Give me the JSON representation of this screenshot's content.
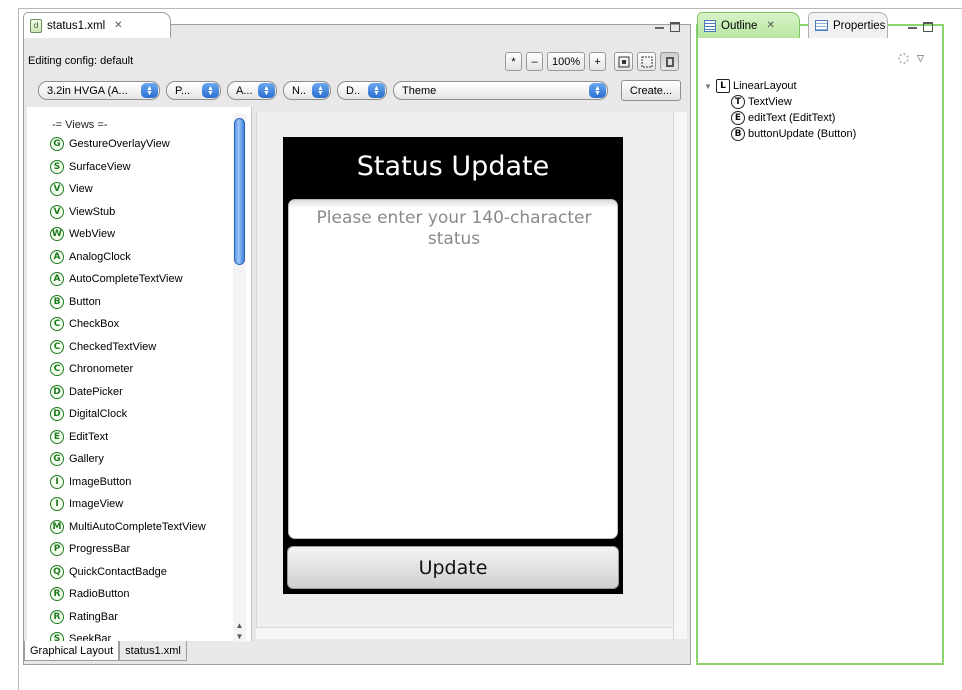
{
  "editor": {
    "tab_label": "status1.xml",
    "config_label": "Editing config:  default",
    "zoom": {
      "star": "*",
      "minus": "–",
      "level": "100%",
      "plus": "+"
    },
    "selects": [
      {
        "label": "3.2in HVGA (A...",
        "width": 122
      },
      {
        "label": "P...",
        "width": 55
      },
      {
        "label": "A...",
        "width": 50
      },
      {
        "label": "N..",
        "width": 48
      },
      {
        "label": "D..",
        "width": 50
      },
      {
        "label": "Theme",
        "width": 215
      }
    ],
    "create_label": "Create...",
    "bottom_tabs": [
      "Graphical Layout",
      "status1.xml"
    ]
  },
  "palette": {
    "header": "-= Views =-",
    "items": [
      {
        "letter": "G",
        "label": "GestureOverlayView"
      },
      {
        "letter": "S",
        "label": "SurfaceView"
      },
      {
        "letter": "V",
        "label": "View"
      },
      {
        "letter": "V",
        "label": "ViewStub"
      },
      {
        "letter": "W",
        "label": "WebView"
      },
      {
        "letter": "A",
        "label": "AnalogClock"
      },
      {
        "letter": "A",
        "label": "AutoCompleteTextView"
      },
      {
        "letter": "B",
        "label": "Button"
      },
      {
        "letter": "C",
        "label": "CheckBox"
      },
      {
        "letter": "C",
        "label": "CheckedTextView"
      },
      {
        "letter": "C",
        "label": "Chronometer"
      },
      {
        "letter": "D",
        "label": "DatePicker"
      },
      {
        "letter": "D",
        "label": "DigitalClock"
      },
      {
        "letter": "E",
        "label": "EditText"
      },
      {
        "letter": "G",
        "label": "Gallery"
      },
      {
        "letter": "I",
        "label": "ImageButton"
      },
      {
        "letter": "I",
        "label": "ImageView"
      },
      {
        "letter": "M",
        "label": "MultiAutoCompleteTextView"
      },
      {
        "letter": "P",
        "label": "ProgressBar"
      },
      {
        "letter": "Q",
        "label": "QuickContactBadge"
      },
      {
        "letter": "R",
        "label": "RadioButton"
      },
      {
        "letter": "R",
        "label": "RatingBar"
      },
      {
        "letter": "S",
        "label": "SeekBar"
      }
    ]
  },
  "preview": {
    "title": "Status Update",
    "hint": "Please enter your 140-character status",
    "button_label": "Update"
  },
  "outline": {
    "tab_outline": "Outline",
    "tab_properties": "Properties",
    "tree": [
      {
        "letter": "L",
        "label": "LinearLayout",
        "depth": 0,
        "expanded": true
      },
      {
        "letter": "T",
        "label": "TextView",
        "depth": 1
      },
      {
        "letter": "E",
        "label": "editText (EditText)",
        "depth": 1
      },
      {
        "letter": "B",
        "label": "buttonUpdate (Button)",
        "depth": 1
      }
    ]
  }
}
